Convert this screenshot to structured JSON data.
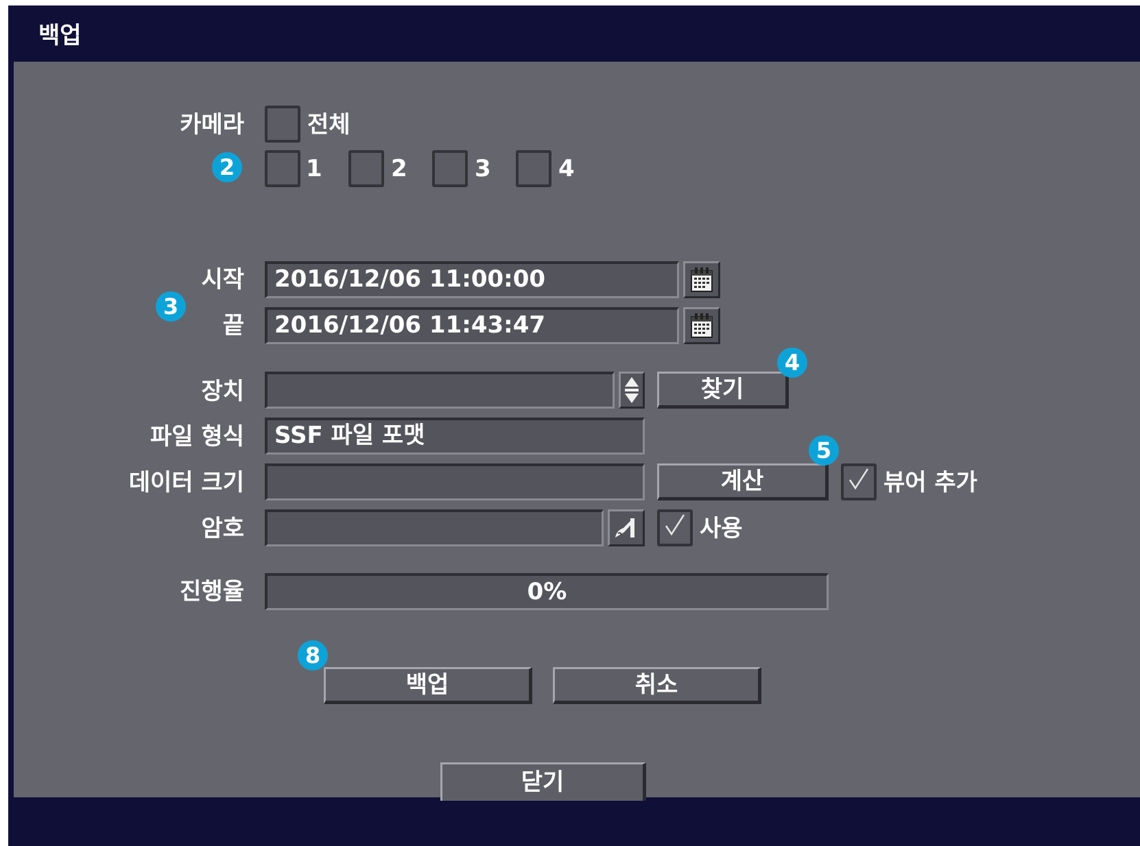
{
  "window": {
    "title": "백업"
  },
  "camera": {
    "label": "카메라",
    "all_label": "전체",
    "channels": [
      "1",
      "2",
      "3",
      "4"
    ]
  },
  "time": {
    "start_label": "시작",
    "start_value": "2016/12/06 11:00:00",
    "end_label": "끝",
    "end_value": "2016/12/06 11:43:47"
  },
  "device": {
    "label": "장치",
    "value": "",
    "find_button": "찾기"
  },
  "file_format": {
    "label": "파일 형식",
    "value": "SSF 파일 포맷"
  },
  "data_size": {
    "label": "데이터 크기",
    "value": "",
    "calc_button": "계산",
    "viewer_label": "뷰어 추가",
    "viewer_checked": true
  },
  "password": {
    "label": "암호",
    "value": "",
    "use_label": "사용",
    "use_checked": true
  },
  "progress": {
    "label": "진행율",
    "value_text": "0%",
    "value": 0
  },
  "actions": {
    "backup_button": "백업",
    "cancel_button": "취소",
    "close_button": "닫기"
  },
  "callouts": [
    "2",
    "3",
    "4",
    "5",
    "8"
  ],
  "colors": {
    "title_bar": "#0f0f38",
    "panel": "#65656d",
    "field": "#54545c",
    "callout": "#0ea3d8"
  }
}
